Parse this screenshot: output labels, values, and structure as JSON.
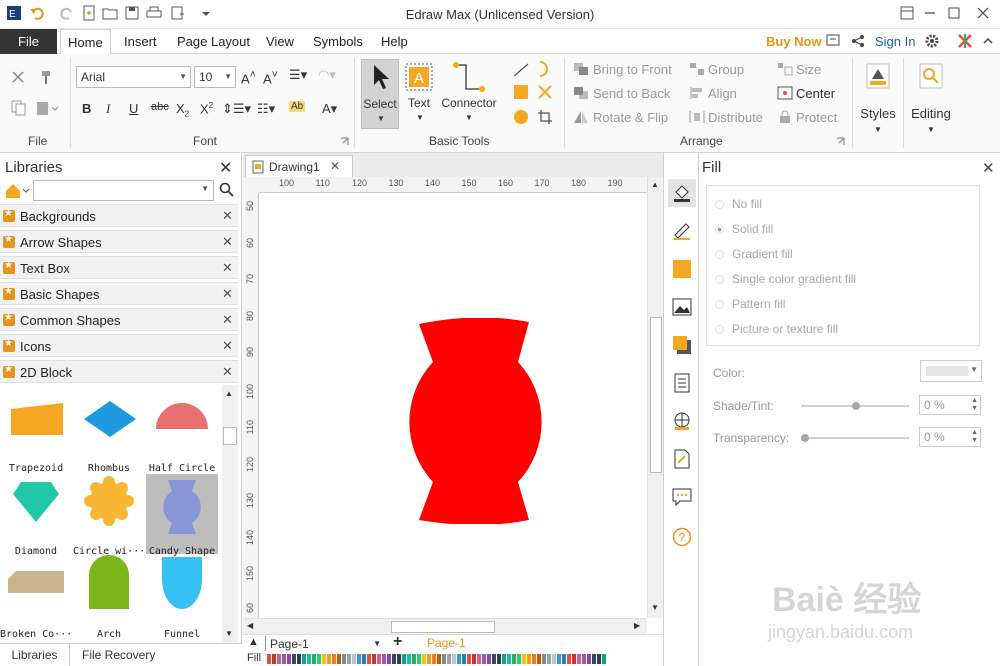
{
  "app": {
    "title": "Edraw Max (Unlicensed Version)"
  },
  "menu": {
    "file": "File",
    "items": [
      "Home",
      "Insert",
      "Page Layout",
      "View",
      "Symbols",
      "Help"
    ],
    "buy_now": "Buy Now",
    "sign_in": "Sign In"
  },
  "ribbon": {
    "groups": {
      "file": "File",
      "font": "Font",
      "basic_tools": "Basic Tools",
      "arrange": "Arrange"
    },
    "font_name": "Arial",
    "font_size": "10",
    "tools": {
      "select": "Select",
      "text": "Text",
      "connector": "Connector"
    },
    "arrange": {
      "bring_to_front": "Bring to Front",
      "send_to_back": "Send to Back",
      "rotate_flip": "Rotate & Flip",
      "group": "Group",
      "align": "Align",
      "distribute": "Distribute",
      "size": "Size",
      "center": "Center",
      "protect": "Protect"
    },
    "styles": "Styles",
    "editing": "Editing"
  },
  "libraries": {
    "title": "Libraries",
    "categories": [
      "Backgrounds",
      "Arrow Shapes",
      "Text Box",
      "Basic Shapes",
      "Common Shapes",
      "Icons",
      "2D Block"
    ],
    "shapes": [
      {
        "label": "Trapezoid",
        "color": "#f5a623"
      },
      {
        "label": "Rhombus",
        "color": "#1e9be0"
      },
      {
        "label": "Half Circle",
        "color": "#e87070"
      },
      {
        "label": "Diamond",
        "color": "#22c7a8"
      },
      {
        "label": "Circle wi···",
        "color": "#f7b733"
      },
      {
        "label": "Candy Shape",
        "color": "#8a95d8"
      },
      {
        "label": "Broken Co···",
        "color": "#c9b48f"
      },
      {
        "label": "Arch",
        "color": "#7cb518"
      },
      {
        "label": "Funnel",
        "color": "#35c1f1"
      }
    ],
    "tabs": {
      "libraries": "Libraries",
      "file_recovery": "File Recovery"
    }
  },
  "document": {
    "tab": "Drawing1",
    "page_select": "Page-1",
    "page_tab": "Page-1",
    "fill_label": "Fill",
    "shape_color": "#ff0000",
    "hruler": [
      "100",
      "110",
      "120",
      "130",
      "140",
      "150",
      "160",
      "170",
      "180",
      "190"
    ],
    "vruler": [
      "50",
      "60",
      "70",
      "80",
      "90",
      "100",
      "110",
      "120",
      "130",
      "140",
      "150",
      "60"
    ]
  },
  "fill_panel": {
    "title": "Fill",
    "options": [
      "No fill",
      "Solid fill",
      "Gradient fill",
      "Single color gradient fill",
      "Pattern fill",
      "Picture or texture fill"
    ],
    "selected_option": "Solid fill",
    "color_label": "Color:",
    "shade_label": "Shade/Tint:",
    "shade_value": "0 %",
    "transparency_label": "Transparency:",
    "transparency_value": "0 %"
  },
  "watermark": {
    "line1": "Baiè 经验",
    "line2": "jingyan.baidu.com"
  }
}
